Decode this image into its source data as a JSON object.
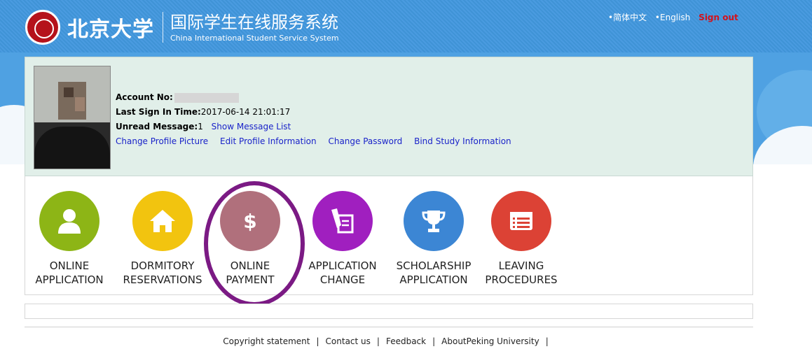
{
  "header": {
    "school_name_cn": "北京大学",
    "system_title_cn": "国际学生在线服务系统",
    "system_title_en": "China International Student Service System",
    "lang_simplified": "•简体中文",
    "lang_english": "•English",
    "sign_out": "Sign out"
  },
  "profile": {
    "account_label": "Account No:",
    "last_sign_in_label": "Last Sign In Time:",
    "last_sign_in_value": "2017-06-14 21:01:17",
    "unread_label": "Unread Message:",
    "unread_count": "1",
    "show_messages": "Show Message List",
    "actions": [
      "Change Profile Picture",
      "Edit Profile Information",
      "Change Password",
      "Bind Study Information"
    ]
  },
  "tiles": [
    {
      "line1": "ONLINE",
      "line2": "APPLICATION",
      "color": "#8db516",
      "icon": "user-icon"
    },
    {
      "line1": "DORMITORY",
      "line2": "RESERVATIONS",
      "color": "#f2c40f",
      "icon": "home-icon"
    },
    {
      "line1": "ONLINE",
      "line2": "PAYMENT",
      "color": "#b0707c",
      "icon": "dollar-icon"
    },
    {
      "line1": "APPLICATION",
      "line2": "CHANGE",
      "color": "#a01fbf",
      "icon": "document-edit-icon"
    },
    {
      "line1": "SCHOLARSHIP",
      "line2": "APPLICATION",
      "color": "#3c86d4",
      "icon": "trophy-icon"
    },
    {
      "line1": "LEAVING",
      "line2": "PROCEDURES",
      "color": "#dc4235",
      "icon": "list-card-icon"
    }
  ],
  "footer": {
    "links": [
      "Copyright statement",
      "Contact us",
      "Feedback",
      "AboutPeking University"
    ]
  }
}
